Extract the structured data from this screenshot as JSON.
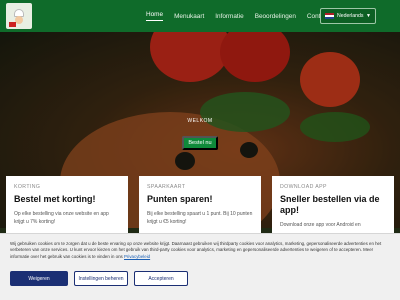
{
  "header": {
    "nav": [
      "Home",
      "Menukaart",
      "Informatie",
      "Beoordelingen",
      "Contact"
    ],
    "active_index": 0,
    "language": "Nederlands"
  },
  "hero": {
    "welcome": "WELKOM",
    "cta": "Bestel nu"
  },
  "cards": [
    {
      "kicker": "KORTING",
      "title": "Bestel met korting!",
      "body": "Op elke bestelling via onze website en app krijgt u 7% korting!"
    },
    {
      "kicker": "SPAARKAART",
      "title": "Punten sparen!",
      "body": "Bij elke bestelling spaart u 1 punt. Bij 10 punten krijgt u €5 korting!"
    },
    {
      "kicker": "DOWNLOAD APP",
      "title": "Sneller bestellen via de app!",
      "body": "Download onze app voor Android en"
    }
  ],
  "cookie": {
    "text": "Wij gebruiken cookies om te zorgen dat u de beste ervaring op onze website krijgt. Daarnaast gebruiken wij thirdparty cookies voor analytics, marketing, gepersonaliseerde advertenties en het verbeteren van onze services. U kunt ervoor kiezen om het gebruik van third-party cookies voor analytics, marketing en gepersonaliseerde advertenties te weigeren of te accepteren. Meer informatie over het gebruik van cookies is te vinden in ons",
    "link": "Privacybeleid",
    "buttons": {
      "reject": "Weigeren",
      "manage": "Instellingen beheren",
      "accept": "Accepteren"
    }
  },
  "colors": {
    "nav_bg": "#0f6b2a",
    "cta_bg": "#0f8a3a",
    "cookie_button": "#1b2f74"
  },
  "icons": [
    "chef-logo",
    "netherlands-flag-icon",
    "chevron-down-icon"
  ]
}
